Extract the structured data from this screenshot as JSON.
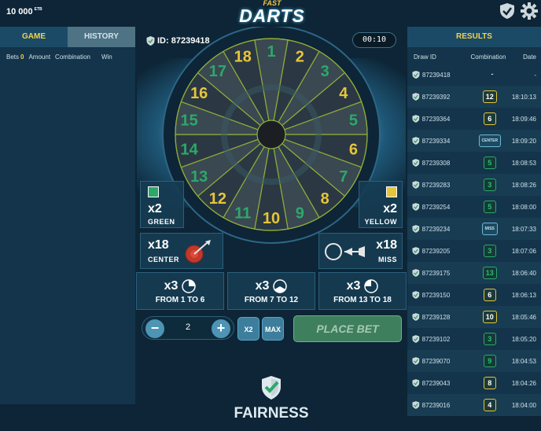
{
  "header": {
    "balance": "10 000",
    "currency": "ETB",
    "logo_small": "FAST",
    "logo_big": "DARTS",
    "icons": [
      "shield-check-icon",
      "gear-icon"
    ]
  },
  "left": {
    "tabs": [
      "GAME",
      "HISTORY"
    ],
    "columns": [
      "Bets",
      "Amount",
      "Combination",
      "Win"
    ],
    "bets_count": "0"
  },
  "game": {
    "id_label": "ID: 87239418",
    "timer": "00:10",
    "board_numbers": [
      "1",
      "2",
      "3",
      "4",
      "5",
      "6",
      "7",
      "8",
      "9",
      "10",
      "11",
      "12",
      "13",
      "14",
      "15",
      "16",
      "17",
      "18"
    ],
    "colors": {
      "green": "#2da86a",
      "yellow": "#e6c53b"
    },
    "bets": {
      "green": {
        "mult": "x2",
        "label": "GREEN"
      },
      "yellow": {
        "mult": "x2",
        "label": "YELLOW"
      },
      "center": {
        "mult": "x18",
        "label": "CENTER"
      },
      "miss": {
        "mult": "x18",
        "label": "MISS"
      },
      "range1": {
        "mult": "x3",
        "label": "FROM 1 TO 6"
      },
      "range2": {
        "mult": "x3",
        "label": "FROM 7 TO 12"
      },
      "range3": {
        "mult": "x3",
        "label": "FROM 13 TO 18"
      }
    },
    "controls": {
      "minus": "−",
      "plus": "+",
      "stake": "2",
      "x2": "X2",
      "max": "MAX",
      "place": "PLACE BET"
    },
    "fairness": "FAIRNESS"
  },
  "results": {
    "title": "RESULTS",
    "columns": [
      "Draw ID",
      "Combination",
      "Date"
    ],
    "rows": [
      {
        "id": "87239418",
        "comb": "-",
        "style": "dash",
        "date": "-"
      },
      {
        "id": "87239392",
        "comb": "12",
        "style": "yellow",
        "date": "18:10:13"
      },
      {
        "id": "87239364",
        "comb": "6",
        "style": "yellow",
        "date": "18:09:46"
      },
      {
        "id": "87239334",
        "comb": "CENTER",
        "style": "word",
        "date": "18:09:20"
      },
      {
        "id": "87239308",
        "comb": "5",
        "style": "green",
        "date": "18:08:53"
      },
      {
        "id": "87239283",
        "comb": "3",
        "style": "green",
        "date": "18:08:26"
      },
      {
        "id": "87239254",
        "comb": "5",
        "style": "green",
        "date": "18:08:00"
      },
      {
        "id": "87239234",
        "comb": "MISS",
        "style": "word",
        "date": "18:07:33"
      },
      {
        "id": "87239205",
        "comb": "3",
        "style": "green",
        "date": "18:07:06"
      },
      {
        "id": "87239175",
        "comb": "13",
        "style": "green",
        "date": "18:06:40"
      },
      {
        "id": "87239150",
        "comb": "6",
        "style": "yellow",
        "date": "18:06:13"
      },
      {
        "id": "87239128",
        "comb": "10",
        "style": "yellow",
        "date": "18:05:46"
      },
      {
        "id": "87239102",
        "comb": "3",
        "style": "green",
        "date": "18:05:20"
      },
      {
        "id": "87239070",
        "comb": "9",
        "style": "green",
        "date": "18:04:53"
      },
      {
        "id": "87239043",
        "comb": "8",
        "style": "yellow",
        "date": "18:04:26"
      },
      {
        "id": "87239016",
        "comb": "4",
        "style": "yellow",
        "date": "18:04:00"
      }
    ]
  }
}
